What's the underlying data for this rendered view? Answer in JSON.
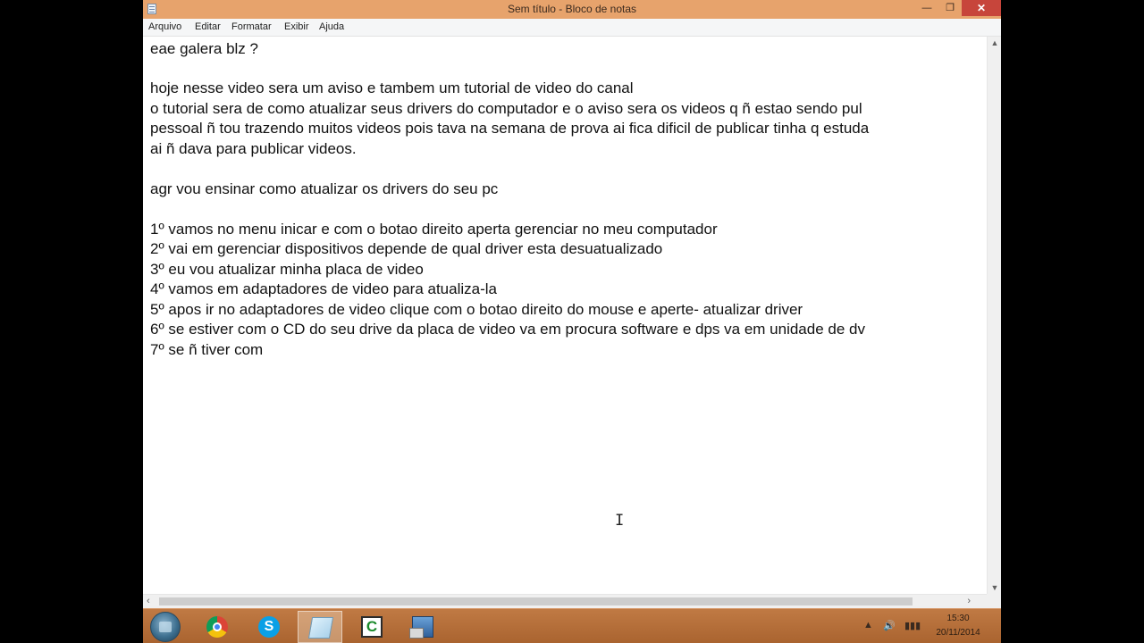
{
  "window": {
    "title": "Sem título - Bloco de notas"
  },
  "menu": {
    "items": [
      "Arquivo",
      "Editar",
      "Formatar",
      "Exibir",
      "Ajuda"
    ]
  },
  "editor": {
    "lines": [
      "eae galera blz ?",
      "",
      "hoje nesse video sera um aviso e tambem um tutorial de video do canal",
      "o tutorial sera de como atualizar seus drivers do computador e o aviso sera os videos q ñ estao sendo pul",
      "pessoal ñ tou trazendo muitos videos pois tava na semana de prova ai fica dificil de publicar tinha q estuda",
      "ai ñ dava para publicar videos.",
      "",
      "agr vou ensinar como atualizar os drivers do seu pc",
      "",
      "1º vamos no menu inicar e com o botao direito aperta gerenciar no meu computador",
      "2º vai em gerenciar dispositivos depende de qual driver esta desuatualizado",
      "3º eu vou atualizar minha placa de video",
      "4º vamos em adaptadores de video para atualiza-la",
      "5º apos ir no adaptadores de video clique com o botao direito do mouse e aperte- atualizar driver",
      "6º se estiver com o CD do seu drive da placa de video va em procura software e dps va em unidade de dv",
      "7º se ñ tiver com"
    ]
  },
  "taskbar": {
    "apps": [
      {
        "name": "chrome",
        "icon": "chrome-icon"
      },
      {
        "name": "skype",
        "icon": "skype-icon",
        "glyph": "S"
      },
      {
        "name": "notepad",
        "icon": "notepad-icon"
      },
      {
        "name": "camtasia",
        "icon": "camtasia-icon",
        "glyph": "C"
      },
      {
        "name": "network",
        "icon": "network-app-icon"
      }
    ],
    "clock": {
      "time": "15:30",
      "date": "20/11/2014"
    }
  },
  "colors": {
    "titlebar": "#e7a36c",
    "taskbar": "#b9733d",
    "close_button": "#c7453b"
  }
}
